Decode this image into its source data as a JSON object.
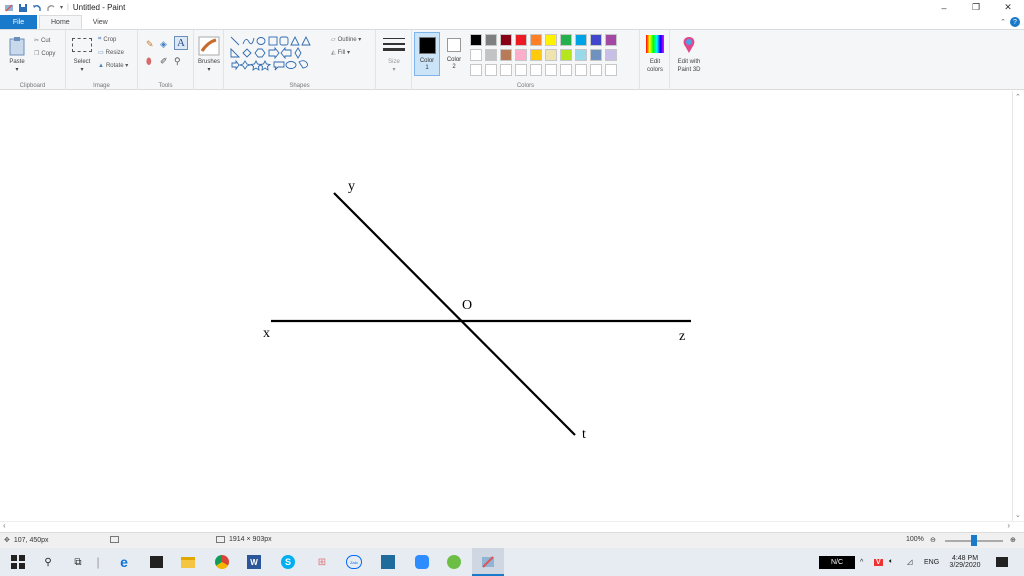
{
  "window": {
    "title": "Untitled - Paint",
    "controls": [
      "–",
      "❐",
      "✕"
    ]
  },
  "tabs": {
    "file": "File",
    "home": "Home",
    "view": "View"
  },
  "ribbon": {
    "clipboard": {
      "label": "Clipboard",
      "paste": "Paste",
      "cut": "Cut",
      "copy": "Copy"
    },
    "image": {
      "label": "Image",
      "select": "Select",
      "crop": "Crop",
      "resize": "Resize",
      "rotate": "Rotate ▾"
    },
    "tools": {
      "label": "Tools"
    },
    "brushes": {
      "label": "Brushes"
    },
    "shapes": {
      "label": "Shapes",
      "outline": "Outline ▾",
      "fill": "Fill ▾"
    },
    "size": {
      "label": "Size"
    },
    "color1": {
      "label": "Color",
      "num": "1"
    },
    "color2": {
      "label": "Color",
      "num": "2"
    },
    "colors": {
      "label": "Colors"
    },
    "edit_colors": {
      "line1": "Edit",
      "line2": "colors"
    },
    "paint3d": {
      "line1": "Edit with",
      "line2": "Paint 3D"
    }
  },
  "palette": [
    "#000000",
    "#7f7f7f",
    "#880015",
    "#ed1c24",
    "#ff7f27",
    "#fff200",
    "#22b14c",
    "#00a2e8",
    "#3f48cc",
    "#a349a4",
    "#ffffff",
    "#c3c3c3",
    "#b97a57",
    "#ffaec9",
    "#ffc90e",
    "#efe4b0",
    "#b5e61d",
    "#99d9ea",
    "#7092be",
    "#c8bfe7",
    "#ffffff",
    "#ffffff",
    "#ffffff",
    "#ffffff",
    "#ffffff",
    "#ffffff",
    "#ffffff",
    "#ffffff",
    "#ffffff",
    "#ffffff"
  ],
  "drawing": {
    "labels": {
      "x": "x",
      "y": "y",
      "z": "z",
      "t": "t",
      "o": "O"
    }
  },
  "status": {
    "cursor": "107, 450px",
    "dimensions": "1914 × 903px",
    "zoom": "100%"
  },
  "taskbar": {
    "time": "4:48 PM",
    "date": "3/29/2020",
    "lang": "ENG",
    "nc": "N/C",
    "zalo": "Zalo"
  }
}
